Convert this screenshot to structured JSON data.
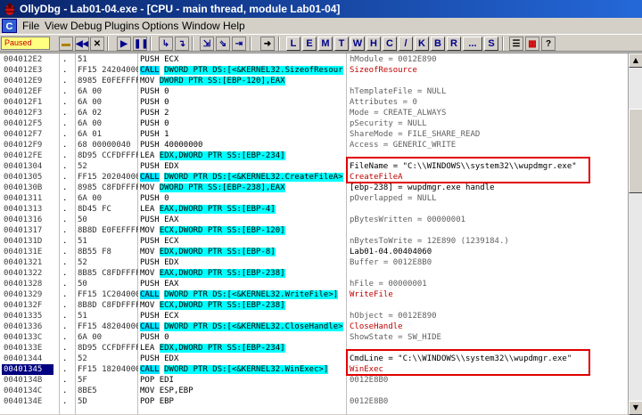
{
  "window": {
    "title": "OllyDbg - Lab01-04.exe - [CPU - main thread, module Lab01-04]"
  },
  "menu": {
    "cpu_icon": "C",
    "items": [
      "File",
      "View",
      "Debug",
      "Plugins",
      "Options",
      "Window",
      "Help"
    ]
  },
  "toolbar": {
    "status": "Paused",
    "letter_buttons": [
      "L",
      "E",
      "M",
      "T",
      "W",
      "H",
      "C",
      "/",
      "K",
      "B",
      "R",
      "...",
      "S"
    ]
  },
  "colors": {
    "title_bg": "#0a246a",
    "selection": "#000080",
    "api_highlight": "#ffff00",
    "call_highlight": "#00ffff",
    "annotation_box": "#e00000"
  },
  "rows": [
    {
      "addr": "004012E2",
      "mark": ".",
      "hex": "51",
      "mn": "PUSH",
      "op": "ECX",
      "cmt": "hModule = 0012E890"
    },
    {
      "addr": "004012E3",
      "mark": ".",
      "hex": "FF15 24204000",
      "mn": "CALL",
      "op": "DWORD PTR DS:[<&KERNEL32.SizeofResour",
      "cmt": "SizeofResource"
    },
    {
      "addr": "004012E9",
      "mark": ".",
      "hex": "8985 E0FEFFFF",
      "mn": "MOV",
      "op": "DWORD PTR SS:[EBP-120],EAX",
      "cmt": ""
    },
    {
      "addr": "004012EF",
      "mark": ".",
      "hex": "6A 00",
      "mn": "PUSH",
      "op": "0",
      "cmt": "hTemplateFile = NULL"
    },
    {
      "addr": "004012F1",
      "mark": ".",
      "hex": "6A 00",
      "mn": "PUSH",
      "op": "0",
      "cmt": "Attributes = 0"
    },
    {
      "addr": "004012F3",
      "mark": ".",
      "hex": "6A 02",
      "mn": "PUSH",
      "op": "2",
      "cmt": "Mode = CREATE_ALWAYS"
    },
    {
      "addr": "004012F5",
      "mark": ".",
      "hex": "6A 00",
      "mn": "PUSH",
      "op": "0",
      "cmt": "pSecurity = NULL"
    },
    {
      "addr": "004012F7",
      "mark": ".",
      "hex": "6A 01",
      "mn": "PUSH",
      "op": "1",
      "cmt": "ShareMode = FILE_SHARE_READ"
    },
    {
      "addr": "004012F9",
      "mark": ".",
      "hex": "68 00000040",
      "mn": "PUSH",
      "op": "40000000",
      "cmt": "Access = GENERIC_WRITE"
    },
    {
      "addr": "004012FE",
      "mark": ".",
      "hex": "8D95 CCFDFFFF",
      "mn": "LEA",
      "op": "EDX,DWORD PTR SS:[EBP-234]",
      "cmt": ""
    },
    {
      "addr": "00401304",
      "mark": ".",
      "hex": "52",
      "mn": "PUSH",
      "op": "EDX",
      "cmt": "FileName = \"C:\\\\WINDOWS\\\\system32\\\\wupdmgr.exe\""
    },
    {
      "addr": "00401305",
      "mark": ".",
      "hex": "FF15 20204000",
      "mn": "CALL",
      "op": "DWORD PTR DS:[<&KERNEL32.CreateFileA>",
      "cmt": "CreateFileA"
    },
    {
      "addr": "0040130B",
      "mark": ".",
      "hex": "8985 C8FDFFFF",
      "mn": "MOV",
      "op": "DWORD PTR SS:[EBP-238],EAX",
      "cmt": "[ebp-238] = wupdmgr.exe handle"
    },
    {
      "addr": "00401311",
      "mark": ".",
      "hex": "6A 00",
      "mn": "PUSH",
      "op": "0",
      "cmt": "pOverlapped = NULL"
    },
    {
      "addr": "00401313",
      "mark": ".",
      "hex": "8D45 FC",
      "mn": "LEA",
      "op": "EAX,DWORD PTR SS:[EBP-4]",
      "cmt": ""
    },
    {
      "addr": "00401316",
      "mark": ".",
      "hex": "50",
      "mn": "PUSH",
      "op": "EAX",
      "cmt": "pBytesWritten = 00000001"
    },
    {
      "addr": "00401317",
      "mark": ".",
      "hex": "8B8D E0FEFFFF",
      "mn": "MOV",
      "op": "ECX,DWORD PTR SS:[EBP-120]",
      "cmt": ""
    },
    {
      "addr": "0040131D",
      "mark": ".",
      "hex": "51",
      "mn": "PUSH",
      "op": "ECX",
      "cmt": "nBytesToWrite = 12E890 (1239184.)"
    },
    {
      "addr": "0040131E",
      "mark": ".",
      "hex": "8B55 F8",
      "mn": "MOV",
      "op": "EDX,DWORD PTR SS:[EBP-8]",
      "cmt": "Lab01-04.00404060"
    },
    {
      "addr": "00401321",
      "mark": ".",
      "hex": "52",
      "mn": "PUSH",
      "op": "EDX",
      "cmt": "Buffer = 0012E8B0"
    },
    {
      "addr": "00401322",
      "mark": ".",
      "hex": "8B85 C8FDFFFF",
      "mn": "MOV",
      "op": "EAX,DWORD PTR SS:[EBP-238]",
      "cmt": ""
    },
    {
      "addr": "00401328",
      "mark": ".",
      "hex": "50",
      "mn": "PUSH",
      "op": "EAX",
      "cmt": "hFile = 00000001"
    },
    {
      "addr": "00401329",
      "mark": ".",
      "hex": "FF15 1C204000",
      "mn": "CALL",
      "op": "DWORD PTR DS:[<&KERNEL32.WriteFile>]",
      "cmt": "WriteFile"
    },
    {
      "addr": "0040132F",
      "mark": ".",
      "hex": "8B8D C8FDFFFF",
      "mn": "MOV",
      "op": "ECX,DWORD PTR SS:[EBP-238]",
      "cmt": ""
    },
    {
      "addr": "00401335",
      "mark": ".",
      "hex": "51",
      "mn": "PUSH",
      "op": "ECX",
      "cmt": "hObject = 0012E890"
    },
    {
      "addr": "00401336",
      "mark": ".",
      "hex": "FF15 48204000",
      "mn": "CALL",
      "op": "DWORD PTR DS:[<&KERNEL32.CloseHandle>",
      "cmt": "CloseHandle"
    },
    {
      "addr": "0040133C",
      "mark": ".",
      "hex": "6A 00",
      "mn": "PUSH",
      "op": "0",
      "cmt": "ShowState = SW_HIDE"
    },
    {
      "addr": "0040133E",
      "mark": ".",
      "hex": "8D95 CCFDFFFF",
      "mn": "LEA",
      "op": "EDX,DWORD PTR SS:[EBP-234]",
      "cmt": ""
    },
    {
      "addr": "00401344",
      "mark": ".",
      "hex": "52",
      "mn": "PUSH",
      "op": "EDX",
      "cmt": "CmdLine = \"C:\\\\WINDOWS\\\\system32\\\\wupdmgr.exe\""
    },
    {
      "addr": "00401345",
      "mark": ".",
      "hex": "FF15 18204000",
      "mn": "CALL",
      "op": "DWORD PTR DS:[<&KERNEL32.WinExec>]",
      "cmt": "WinExec"
    },
    {
      "addr": "0040134B",
      "mark": ".",
      "hex": "5F",
      "mn": "POP",
      "op": "EDI",
      "cmt": "0012E8B0"
    },
    {
      "addr": "0040134C",
      "mark": ".",
      "hex": "8BE5",
      "mn": "MOV",
      "op": "ESP,EBP",
      "cmt": ""
    },
    {
      "addr": "0040134E",
      "mark": ".",
      "hex": "5D",
      "mn": "POP",
      "op": "EBP",
      "cmt": "0012E8B0"
    }
  ]
}
